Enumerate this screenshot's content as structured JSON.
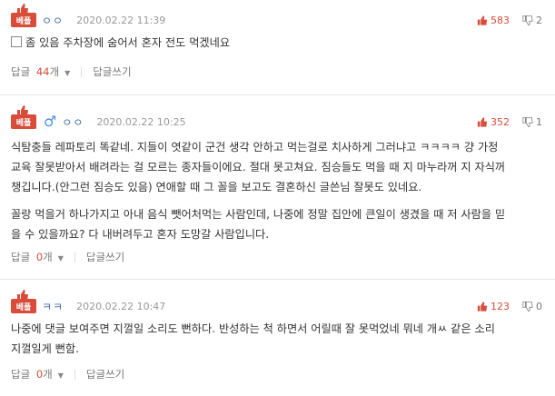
{
  "colors": {
    "accent": "#d94c3a",
    "nick": "#4a6fa5",
    "gender_male": "#4a90e2"
  },
  "badge_label": "베플",
  "reply_label": "답글",
  "reply_unit": "개",
  "write_reply_label": "답글쓰기",
  "comments": [
    {
      "nick": "ㅇㅇ",
      "gender": null,
      "date": "2020.02.22 11:39",
      "up": "583",
      "down": "2",
      "lines": [
        "좀 있음 주차장에 숨어서 혼자 전도 먹겠네요"
      ],
      "has_image_icon": true,
      "reply_count": "44"
    },
    {
      "nick": "ㅇㅇ",
      "gender": "♂",
      "date": "2020.02.22 10:25",
      "up": "352",
      "down": "1",
      "lines": [
        "식탐충들 레파토리 똑같네. 지들이 엿같이 군건 생각 안하고 먹는걸로 치사하게 그러냐고 ㅋㅋㅋㅋ 걍 가정",
        "교육 잘못받아서 배려라는 걸 모르는 종자들이에요. 절대 못고쳐요. 짐승들도 먹을 때 지 마누라꺼 지 자식꺼",
        "챙깁니다.(안그런 짐승도 있음) 연애할 때 그 꼴을 보고도 결혼하신 글쓴님 잘못도 있네요.",
        "",
        "꼴랑 먹을거 하나가지고 아내 음식 뺏어처먹는 사람인데, 나중에 정말 집안에 큰일이 생겼을 때 저 사람을 믿",
        "을 수 있을까요? 다 내버려두고 혼자 도망갈 사람입니다."
      ],
      "has_image_icon": false,
      "reply_count": "0"
    },
    {
      "nick": "ㅋㅋ",
      "gender": null,
      "date": "2020.02.22 10:47",
      "up": "123",
      "down": "0",
      "lines": [
        "나중에 댓글 보여주면 지껄일 소리도 뻔하다. 반성하는 척 하면서 어릴때 잘 못먹었네 뭐네 개ㅆ 같은 소리",
        "지껄일게 뻔함."
      ],
      "has_image_icon": false,
      "reply_count": "0"
    }
  ]
}
